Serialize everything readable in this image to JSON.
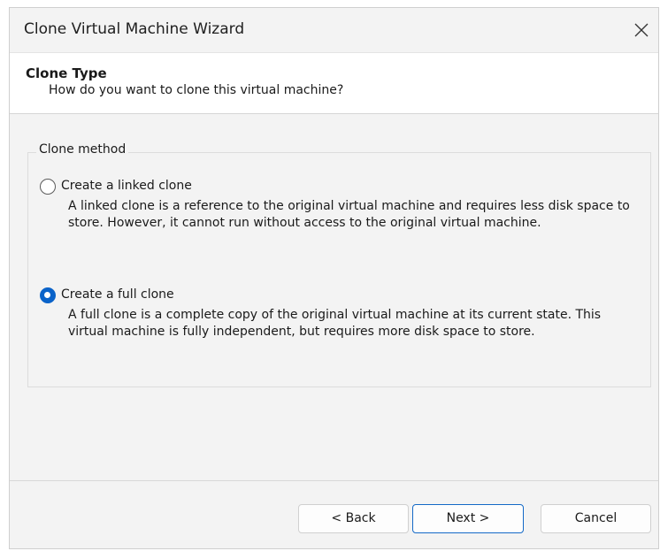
{
  "window": {
    "title": "Clone Virtual Machine Wizard",
    "close_icon": "close-icon"
  },
  "header": {
    "title": "Clone Type",
    "subtitle": "How do you want to clone this virtual machine?"
  },
  "clone_method": {
    "legend": "Clone method",
    "options": [
      {
        "label": "Create a linked clone",
        "description": "A linked clone is a reference to the original virtual machine and requires less disk space to store. However, it cannot run without access to the original virtual machine.",
        "selected": false
      },
      {
        "label": "Create a full clone",
        "description": "A full clone is a complete copy of the original virtual machine at its current state. This virtual machine is fully independent, but requires more disk space to store.",
        "selected": true
      }
    ]
  },
  "buttons": {
    "back": "< Back",
    "next": "Next >",
    "cancel": "Cancel"
  },
  "colors": {
    "accent": "#0a63c9",
    "window_bg": "#f3f3f3",
    "header_bg": "#ffffff"
  }
}
